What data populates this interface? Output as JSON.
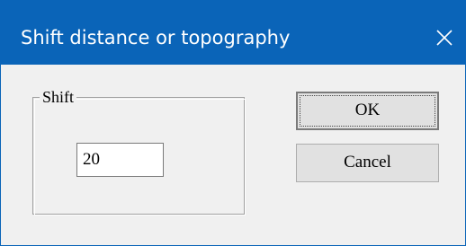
{
  "window": {
    "title": "Shift distance or topography",
    "close_icon": "close-icon",
    "accent_color": "#0a64b8"
  },
  "group": {
    "label": "Shift"
  },
  "shift_input": {
    "value": "20"
  },
  "buttons": {
    "ok_label": "OK",
    "cancel_label": "Cancel"
  }
}
